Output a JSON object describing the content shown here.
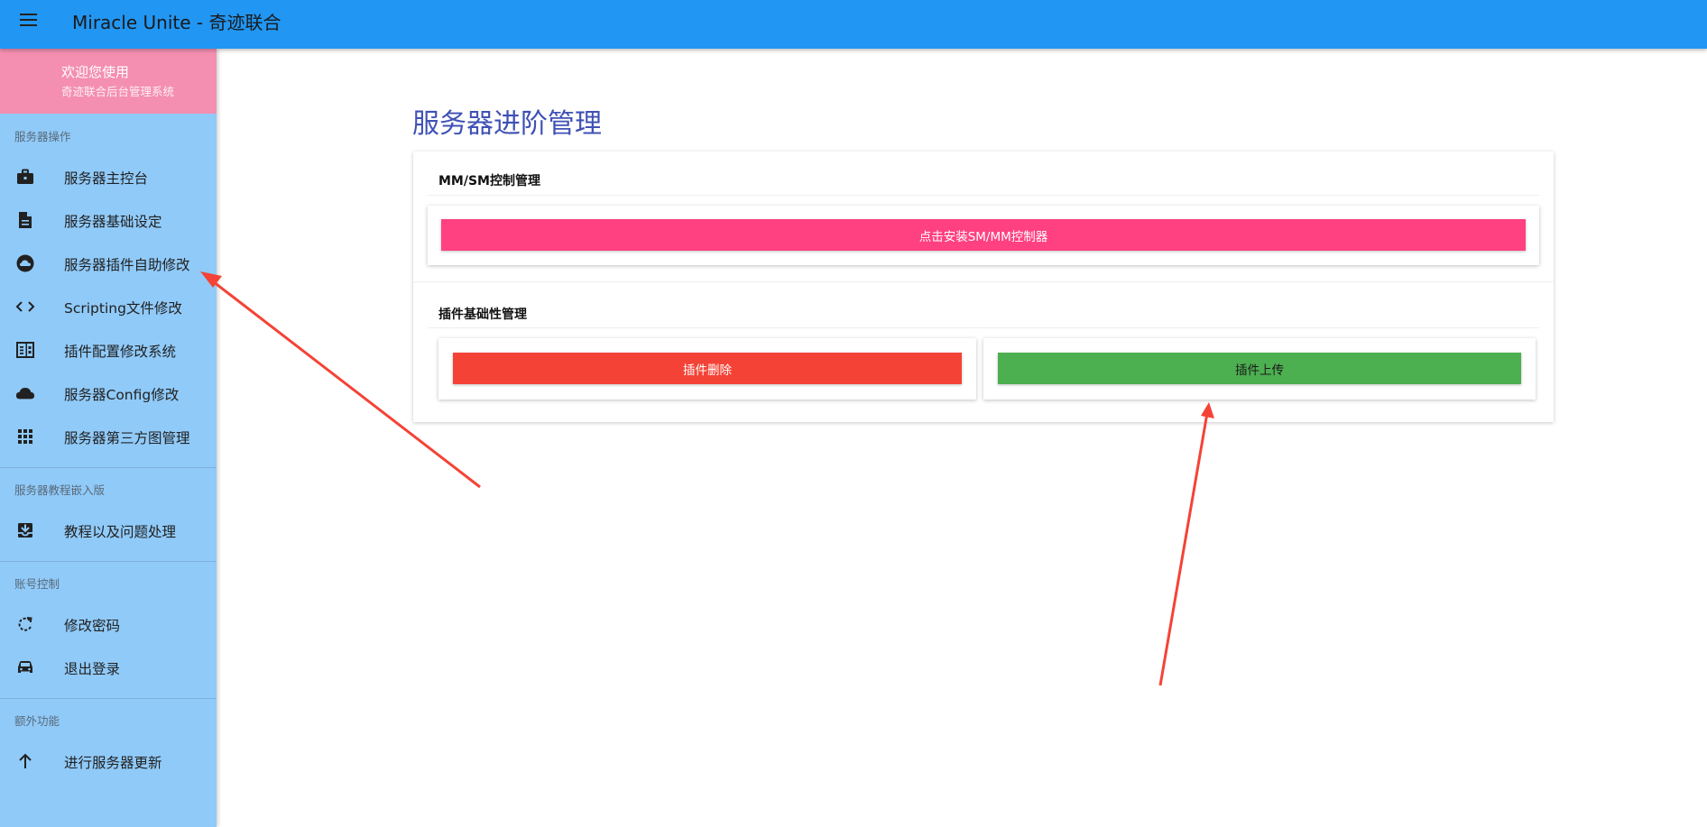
{
  "app": {
    "title": "Miracle Unite - 奇迹联合",
    "menu_icon": "hamburger-menu-icon",
    "bar_color": "#2196f3"
  },
  "sidebar": {
    "bg_color": "#90caf9",
    "header": {
      "title": "欢迎您使用",
      "subtitle": "奇迹联合后台管理系统",
      "bg_color": "#f48fb1"
    },
    "sections": [
      {
        "label": "服务器操作",
        "items": [
          {
            "label": "服务器主控台",
            "icon": "briefcase-icon"
          },
          {
            "label": "服务器基础设定",
            "icon": "document-icon"
          },
          {
            "label": "服务器插件自助修改",
            "icon": "cloud-circle-icon"
          },
          {
            "label": "Scripting文件修改",
            "icon": "code-icon"
          },
          {
            "label": "插件配置修改系统",
            "icon": "chrome-reader-icon"
          },
          {
            "label": "服务器Config修改",
            "icon": "cloud-icon"
          },
          {
            "label": "服务器第三方图管理",
            "icon": "apps-grid-icon"
          }
        ]
      },
      {
        "label": "服务器教程嵌入版",
        "items": [
          {
            "label": "教程以及问题处理",
            "icon": "move-to-inbox-icon"
          }
        ]
      },
      {
        "label": "账号控制",
        "items": [
          {
            "label": "修改密码",
            "icon": "refresh-icon"
          },
          {
            "label": "退出登录",
            "icon": "car-icon"
          }
        ]
      },
      {
        "label": "额外功能",
        "items": [
          {
            "label": "进行服务器更新",
            "icon": "arrow-up-icon"
          }
        ]
      }
    ]
  },
  "main": {
    "page_title": "服务器进阶管理",
    "title_color": "#3f51b5",
    "mm_section": {
      "title": "MM/SM控制管理",
      "install_button": "点击安装SM/MM控制器",
      "install_color": "#ff4081"
    },
    "plugin_section": {
      "title": "插件基础性管理",
      "delete_button": "插件删除",
      "delete_color": "#f44336",
      "upload_button": "插件上传",
      "upload_color": "#4caf50"
    }
  },
  "annotations": {
    "arrow_color": "#f44336"
  }
}
